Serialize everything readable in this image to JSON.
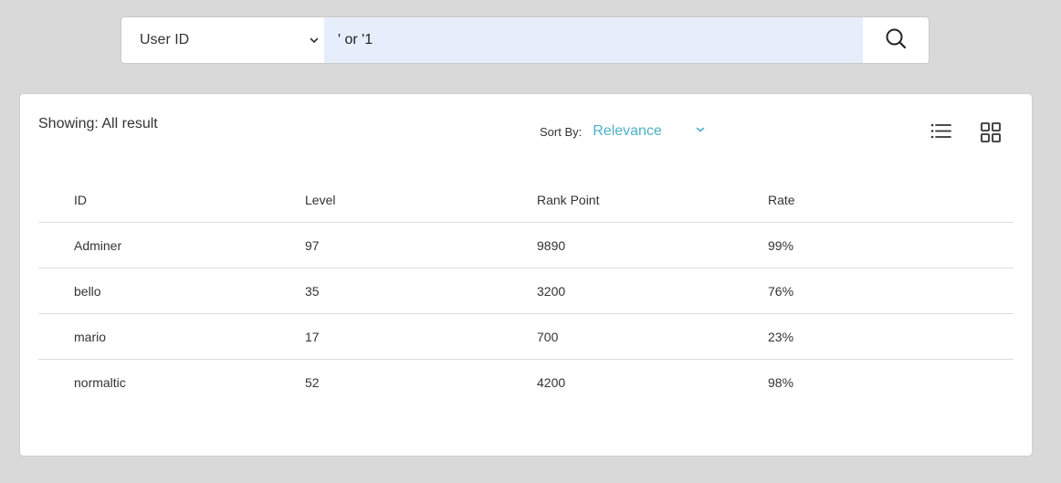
{
  "search": {
    "field_selected": "User ID",
    "query": "' or '1",
    "icons": {
      "dropdown": "chevron-down-icon",
      "submit": "search-icon"
    }
  },
  "results": {
    "showing_text": "Showing: All result",
    "sort_label": "Sort By:",
    "sort_value": "Relevance",
    "view_icons": {
      "list": "list-view-icon",
      "grid": "grid-view-icon"
    },
    "columns": [
      "ID",
      "Level",
      "Rank Point",
      "Rate"
    ],
    "rows": [
      [
        "Adminer",
        "97",
        "9890",
        "99%"
      ],
      [
        "bello",
        "35",
        "3200",
        "76%"
      ],
      [
        "mario",
        "17",
        "700",
        "23%"
      ],
      [
        "normaltic",
        "52",
        "4200",
        "98%"
      ]
    ]
  },
  "colors": {
    "background": "#d9d9d9",
    "input_highlight": "#e6edfb",
    "accent": "#4fb0c6"
  }
}
